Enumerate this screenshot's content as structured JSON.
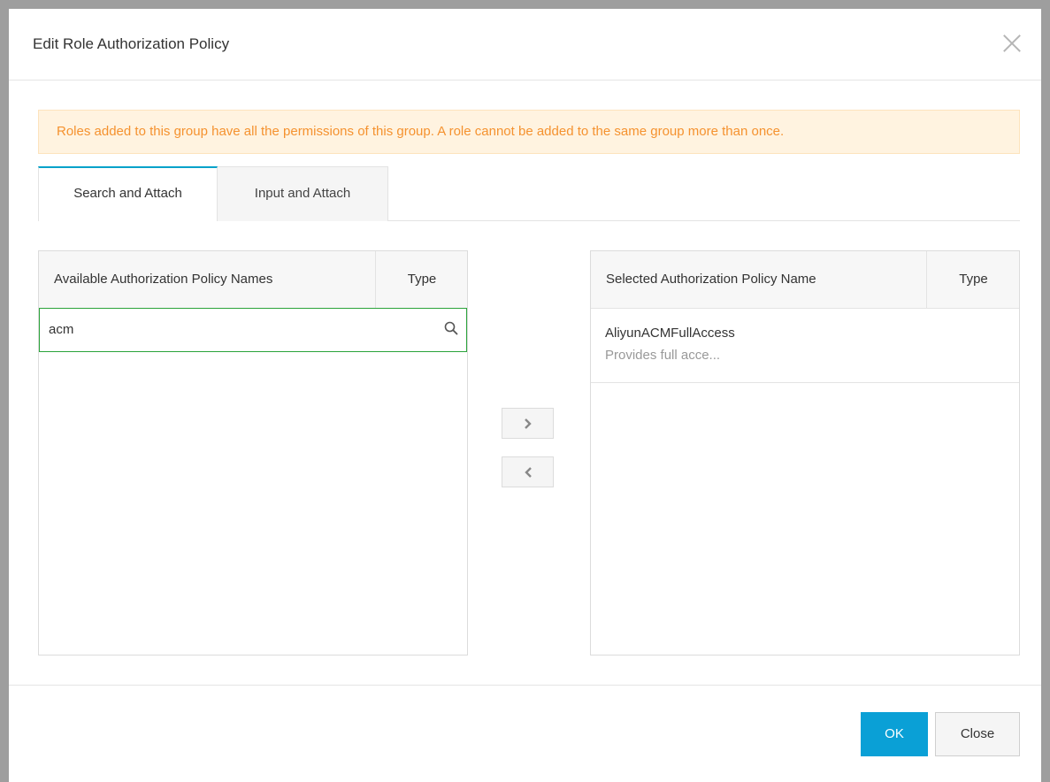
{
  "dialog": {
    "title": "Edit Role Authorization Policy",
    "notice": "Roles added to this group have all the permissions of this group. A role cannot be added to the same group more than once."
  },
  "tabs": [
    {
      "label": "Search and Attach",
      "active": true
    },
    {
      "label": "Input and Attach",
      "active": false
    }
  ],
  "available": {
    "header_name": "Available Authorization Policy Names",
    "header_type": "Type",
    "search_value": "acm"
  },
  "selected": {
    "header_name": "Selected Authorization Policy Name",
    "header_type": "Type",
    "items": [
      {
        "name": "AliyunACMFullAccess",
        "description": "Provides full acce..."
      }
    ]
  },
  "buttons": {
    "ok": "OK",
    "close": "Close"
  },
  "colors": {
    "accent": "#00a2ca",
    "ok_button": "#0aa0d6",
    "notice_text": "#f5922f",
    "notice_bg": "#fff3e0",
    "search_border": "#2aa33a"
  },
  "icons": [
    "close-icon",
    "search-icon",
    "chevron-right-icon",
    "chevron-left-icon"
  ]
}
